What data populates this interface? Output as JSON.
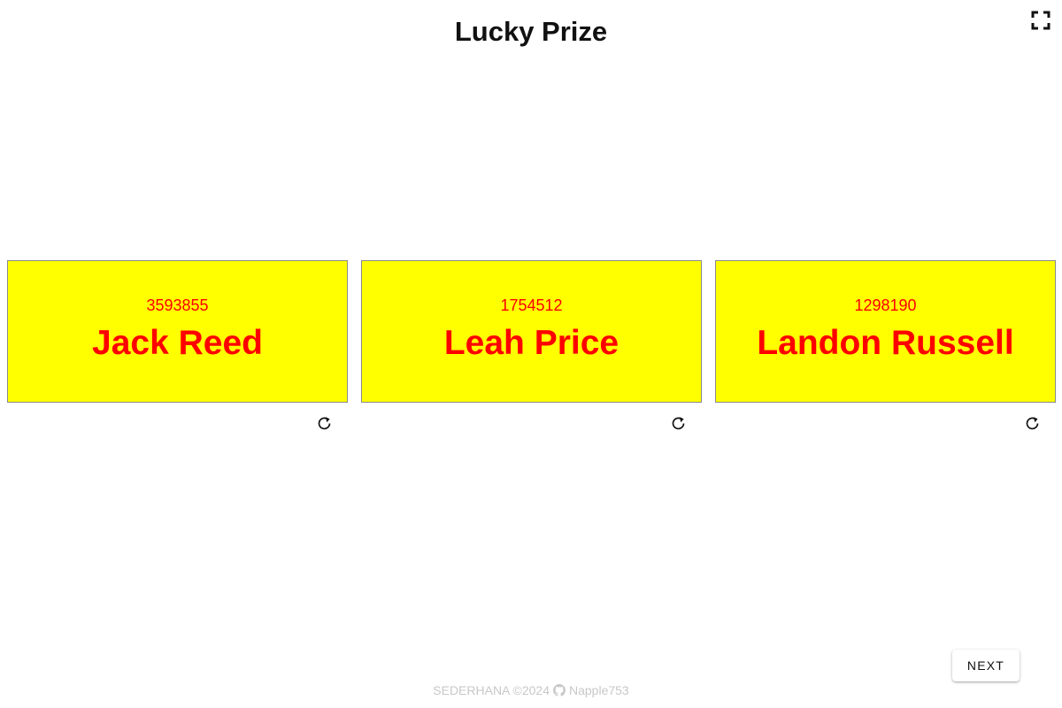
{
  "title": "Lucky Prize",
  "colors": {
    "card_background": "#ffff00",
    "card_text": "#ff0000",
    "card_border": "#8a8a8a",
    "footer_text": "#c8c8c8"
  },
  "icons": {
    "fullscreen": "fullscreen-icon",
    "refresh": "refresh-icon",
    "github": "github-icon"
  },
  "winners": [
    {
      "number": "3593855",
      "name": "Jack Reed"
    },
    {
      "number": "1754512",
      "name": "Leah Price"
    },
    {
      "number": "1298190",
      "name": "Landon Russell"
    }
  ],
  "next_label": "NEXT",
  "footer": {
    "text": "SEDERHANA ©2024",
    "github_user": "Napple753"
  }
}
